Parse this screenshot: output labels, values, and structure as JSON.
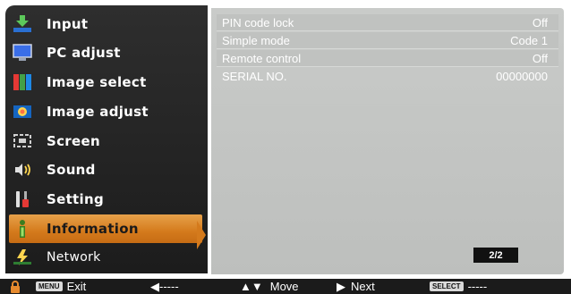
{
  "menu": {
    "items": [
      {
        "label": "Input",
        "icon": "input-icon"
      },
      {
        "label": "PC adjust",
        "icon": "pc-adjust-icon"
      },
      {
        "label": "Image select",
        "icon": "image-select-icon"
      },
      {
        "label": "Image adjust",
        "icon": "image-adjust-icon"
      },
      {
        "label": "Screen",
        "icon": "screen-icon"
      },
      {
        "label": "Sound",
        "icon": "sound-icon"
      },
      {
        "label": "Setting",
        "icon": "setting-icon"
      },
      {
        "label": "Information",
        "icon": "information-icon"
      },
      {
        "label": "Network",
        "icon": "network-icon"
      }
    ],
    "active": "Information",
    "accent": "#d47a1c"
  },
  "panel": {
    "rows": [
      {
        "label": "PIN code lock",
        "value": "Off"
      },
      {
        "label": "Simple mode",
        "value": "Code 1"
      },
      {
        "label": "Remote control",
        "value": "Off"
      },
      {
        "label": "SERIAL NO.",
        "value": "00000000"
      }
    ],
    "page": "2/2"
  },
  "footer": {
    "menu_key": "MENU",
    "exit_label": "Exit",
    "back_arrow": "◀-----",
    "move_label": "Move",
    "next_label": "Next",
    "select_key": "SELECT",
    "select_dashes": "-----"
  }
}
